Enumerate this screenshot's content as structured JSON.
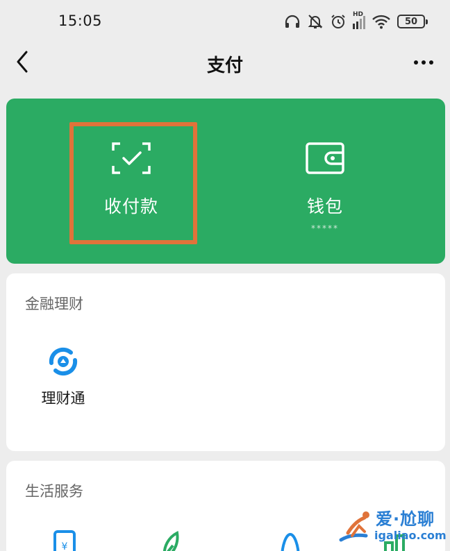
{
  "status_bar": {
    "time": "15:05",
    "network_badge": "HD",
    "battery_level": "50"
  },
  "nav": {
    "title": "支付"
  },
  "pay_card": {
    "receive_label": "收付款",
    "wallet_label": "钱包",
    "wallet_balance": "*****",
    "background_color": "#2bab63",
    "highlight_color": "#e0733a"
  },
  "finance_section": {
    "title": "金融理财",
    "items": [
      {
        "label": "理财通",
        "icon": "licaitong-icon"
      }
    ]
  },
  "life_section": {
    "title": "生活服务",
    "items": [
      {
        "label": "",
        "icon": "mobile-topup-icon"
      },
      {
        "label": "",
        "icon": "green-leaf-icon"
      },
      {
        "label": "",
        "icon": "qq-icon"
      },
      {
        "label": "",
        "icon": "city-service-icon"
      }
    ]
  },
  "watermark": {
    "top": "爱·尬聊",
    "bottom": "igaliao.com"
  }
}
